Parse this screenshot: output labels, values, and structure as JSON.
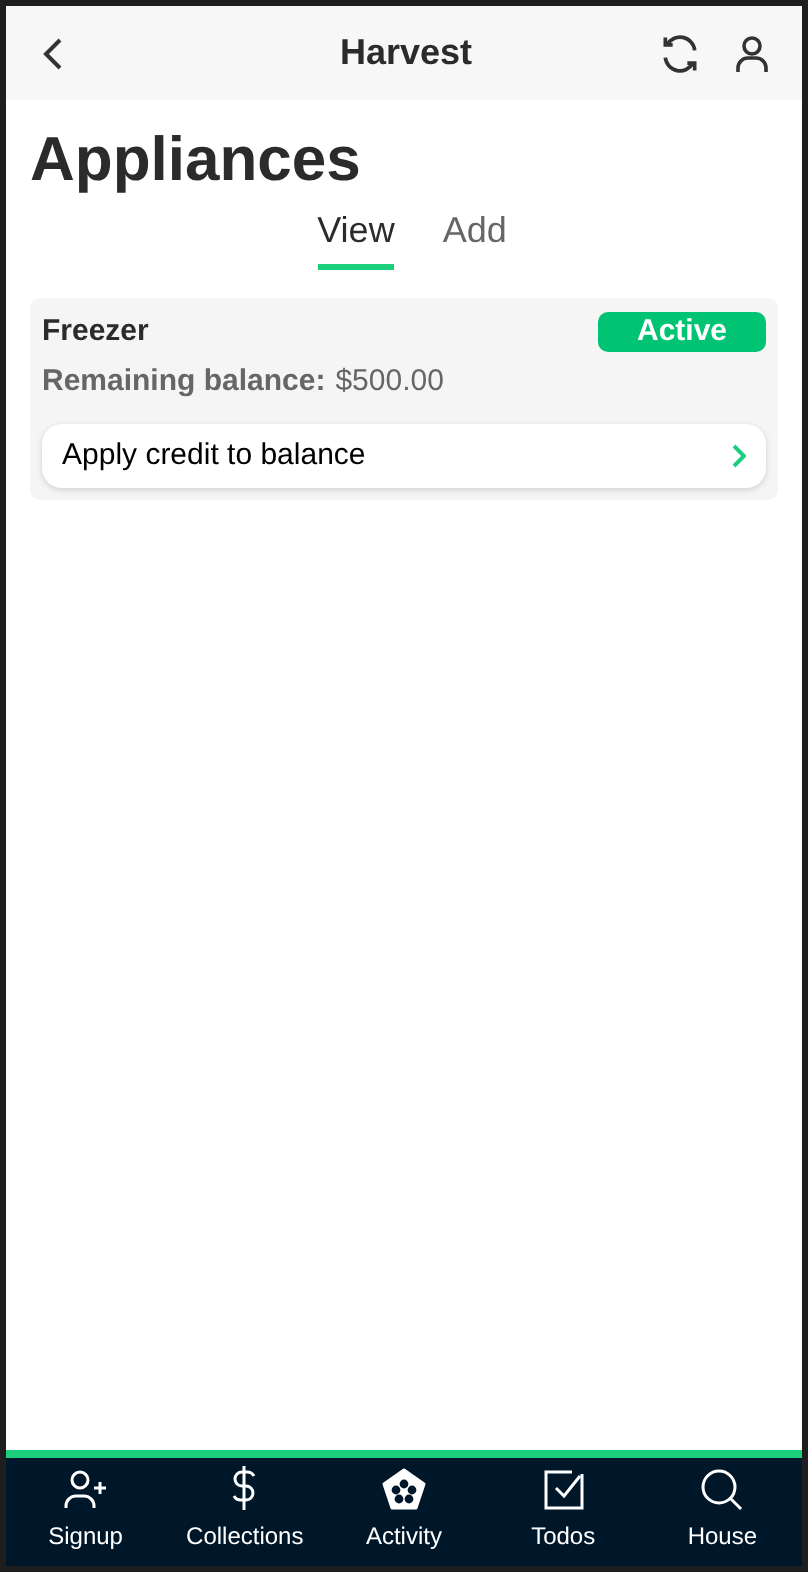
{
  "header": {
    "title": "Harvest"
  },
  "page_title": "Appliances",
  "tabs": [
    {
      "label": "View",
      "selected": true
    },
    {
      "label": "Add",
      "selected": false
    }
  ],
  "cards": [
    {
      "name": "Freezer",
      "status": "Active",
      "balance_label": "Remaining balance:",
      "balance": "$500.00",
      "action": "Apply credit to balance"
    }
  ],
  "nav": [
    {
      "kind": "person-add",
      "label": "Signup"
    },
    {
      "kind": "dollar",
      "label": "Collections"
    },
    {
      "kind": "pentagon",
      "label": "Activity"
    },
    {
      "kind": "check",
      "label": "Todos"
    },
    {
      "kind": "search",
      "label": "House"
    }
  ]
}
